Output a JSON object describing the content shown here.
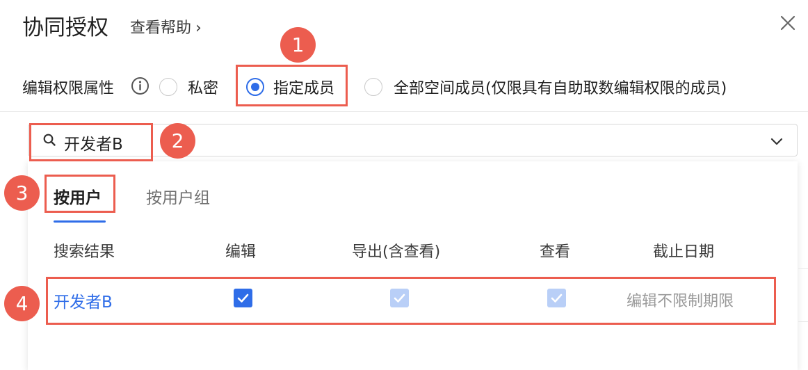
{
  "dialog": {
    "title": "协同授权",
    "help_link": "查看帮助",
    "help_chevron": "›"
  },
  "permission": {
    "label": "编辑权限属性",
    "options": [
      {
        "label": "私密",
        "checked": false
      },
      {
        "label": "指定成员",
        "checked": true
      },
      {
        "label": "全部空间成员(仅限具有自助取数编辑权限的成员)",
        "checked": false
      }
    ]
  },
  "search": {
    "value": "开发者B"
  },
  "tabs": [
    {
      "label": "按用户",
      "active": true
    },
    {
      "label": "按用户组",
      "active": false
    }
  ],
  "table": {
    "columns": [
      "搜索结果",
      "编辑",
      "导出(含查看)",
      "查看",
      "截止日期"
    ],
    "rows": [
      {
        "name": "开发者B",
        "edit": true,
        "export": true,
        "view": true,
        "deadline": "编辑不限制期限"
      }
    ]
  },
  "annotations": [
    "1",
    "2",
    "3",
    "4"
  ],
  "colors": {
    "accent": "#2f6de8",
    "annotation": "#ec5d4f",
    "checkbox_disabled": "#b9cff7"
  },
  "icons": [
    "info-icon",
    "search-icon",
    "chevron-down-icon",
    "close-icon",
    "check-icon"
  ]
}
